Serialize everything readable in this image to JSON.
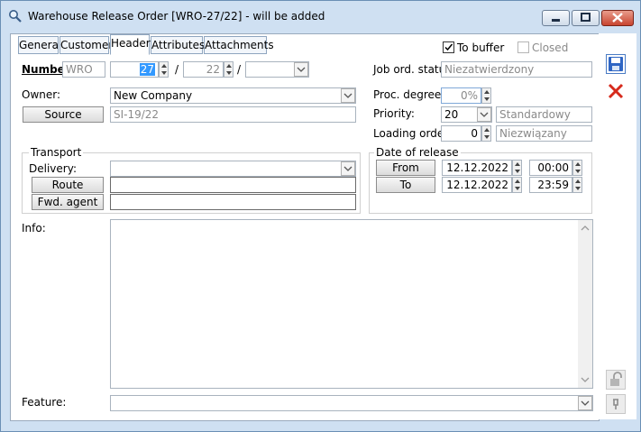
{
  "window": {
    "title": "Warehouse Release Order [WRO-27/22]  - will be added"
  },
  "tabs": [
    {
      "label": "General"
    },
    {
      "label": "Customer"
    },
    {
      "label": "Header",
      "active": true
    },
    {
      "label": "Attributes"
    },
    {
      "label": "Attachments"
    }
  ],
  "options": {
    "to_buffer_label": "To buffer",
    "to_buffer_checked": true,
    "closed_label": "Closed",
    "closed_checked": false
  },
  "number": {
    "label": "Number",
    "prefix": "WRO",
    "seq": "27",
    "year": "22",
    "sep1": "/",
    "sep2": "/",
    "series": ""
  },
  "owner": {
    "label": "Owner:",
    "value": "New Company"
  },
  "source": {
    "button_label": "Source",
    "value": "SI-19/22"
  },
  "job_order": {
    "label": "Job ord. status",
    "value": "Niezatwierdzony"
  },
  "proc_degree": {
    "label": "Proc. degree:",
    "value": "0%"
  },
  "priority": {
    "label": "Priority:",
    "value": "20",
    "desc": "Standardowy"
  },
  "loading_order": {
    "label": "Loading order:",
    "value": "0",
    "desc": "Niezwiązany"
  },
  "transport": {
    "group_label": "Transport",
    "delivery_label": "Delivery:",
    "delivery_value": "",
    "route_button": "Route",
    "route_value": "",
    "agent_button": "Fwd. agent",
    "agent_value": ""
  },
  "release": {
    "group_label": "Date of release",
    "from_button": "From",
    "from_date": "12.12.2022",
    "from_time": "00:00",
    "to_button": "To",
    "to_date": "12.12.2022",
    "to_time": "23:59"
  },
  "info": {
    "label": "Info:",
    "value": ""
  },
  "feature": {
    "label": "Feature:",
    "value": ""
  },
  "colors": {
    "title_bg": "#cfe0f2",
    "selection": "#3399ff",
    "close_red": "#c84530"
  },
  "icons": [
    "search-icon",
    "minimize-icon",
    "maximize-icon",
    "close-icon",
    "save-icon",
    "cancel-icon",
    "lock-icon",
    "pin-icon",
    "chevron-down-icon"
  ]
}
